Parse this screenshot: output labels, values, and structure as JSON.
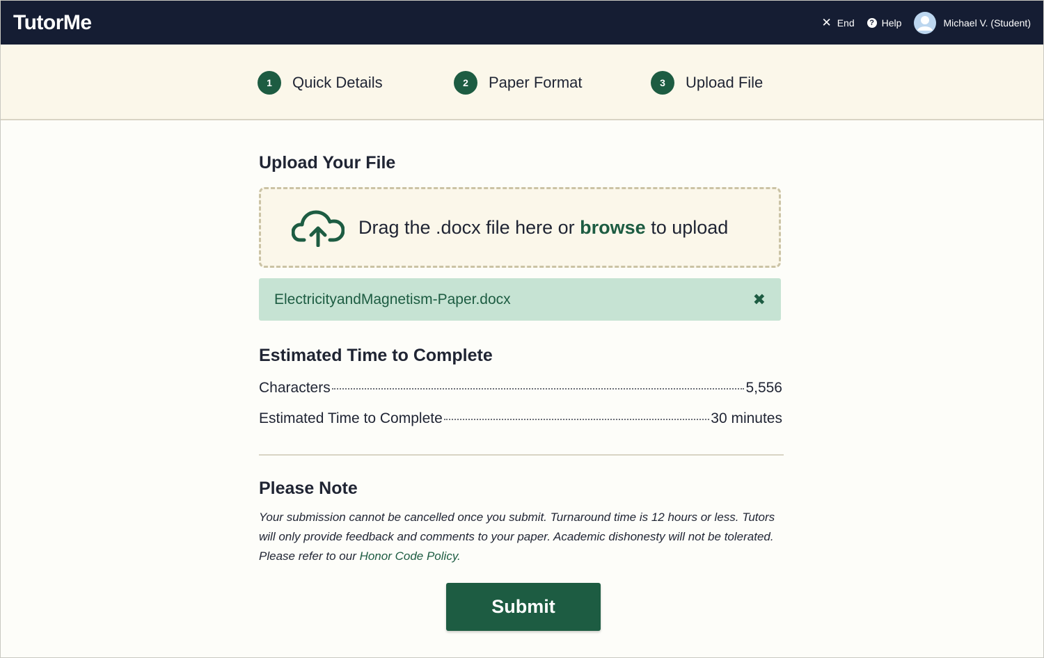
{
  "header": {
    "logo": "TutorMe",
    "end_label": "End",
    "help_label": "Help",
    "user_label": "Michael V. (Student)"
  },
  "steps": [
    {
      "number": "1",
      "label": "Quick Details"
    },
    {
      "number": "2",
      "label": "Paper Format"
    },
    {
      "number": "3",
      "label": "Upload File"
    }
  ],
  "upload": {
    "title": "Upload Your File",
    "drop_text_before": "Drag the .docx file here or ",
    "browse_label": "browse",
    "drop_text_after": " to upload",
    "file_name": "ElectricityandMagnetism-Paper.docx"
  },
  "estimate": {
    "title": "Estimated Time to Complete",
    "rows": [
      {
        "label": "Characters",
        "value": "5,556"
      },
      {
        "label": "Estimated Time to Complete",
        "value": "30 minutes"
      }
    ]
  },
  "note": {
    "title": "Please Note",
    "text": "Your submission cannot be cancelled once you submit. Turnaround time is 12 hours or less. Tutors will only provide feedback and comments to your paper. Academic dishonesty will not be tolerated. Please refer to our ",
    "link_label": "Honor Code Policy."
  },
  "submit_label": "Submit",
  "colors": {
    "header_bg": "#151d33",
    "accent_green": "#1d5c42",
    "file_row_bg": "#c6e3d3",
    "band_bg": "#fbf7ea"
  },
  "icons": {
    "end": "close-icon",
    "help": "help-circle-icon",
    "avatar": "user-avatar-icon",
    "upload": "cloud-upload-icon",
    "remove": "remove-file-icon"
  }
}
